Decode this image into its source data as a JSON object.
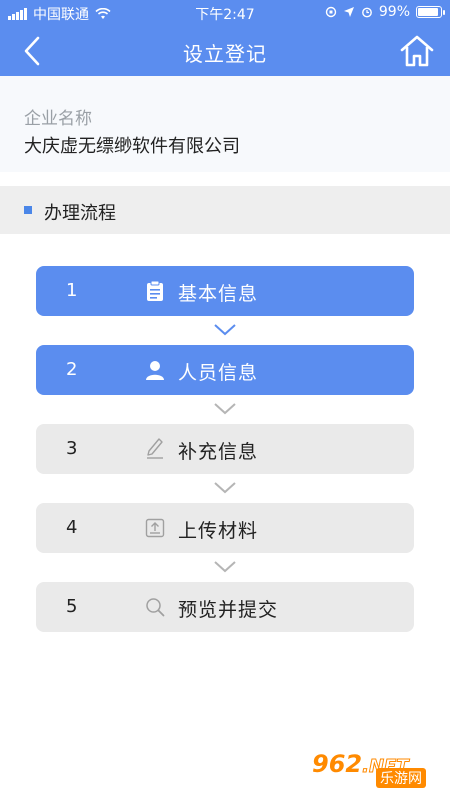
{
  "status_bar": {
    "carrier": "中国联通",
    "time": "下午2:47",
    "battery": "99%",
    "battery_level": 0.99
  },
  "nav": {
    "title": "设立登记",
    "back_icon": "chevron-left-icon",
    "home_icon": "home-icon"
  },
  "company": {
    "label": "企业名称",
    "name": "大庆虚无缥缈软件有限公司"
  },
  "section": {
    "title": "办理流程"
  },
  "steps": [
    {
      "num": "1",
      "label": "基本信息",
      "icon": "clipboard-icon",
      "active": true
    },
    {
      "num": "2",
      "label": "人员信息",
      "icon": "person-icon",
      "active": true
    },
    {
      "num": "3",
      "label": "补充信息",
      "icon": "pen-icon",
      "active": false
    },
    {
      "num": "4",
      "label": "上传材料",
      "icon": "upload-icon",
      "active": false
    },
    {
      "num": "5",
      "label": "预览并提交",
      "icon": "search-icon",
      "active": false
    }
  ],
  "colors": {
    "primary": "#5b8def",
    "inactive": "#eaeaea",
    "chevron_active": "#5b8def",
    "chevron_inactive": "#b5b5b5"
  },
  "watermark": {
    "brand": "962",
    "suffix": ".NET",
    "sub": "乐游网"
  }
}
